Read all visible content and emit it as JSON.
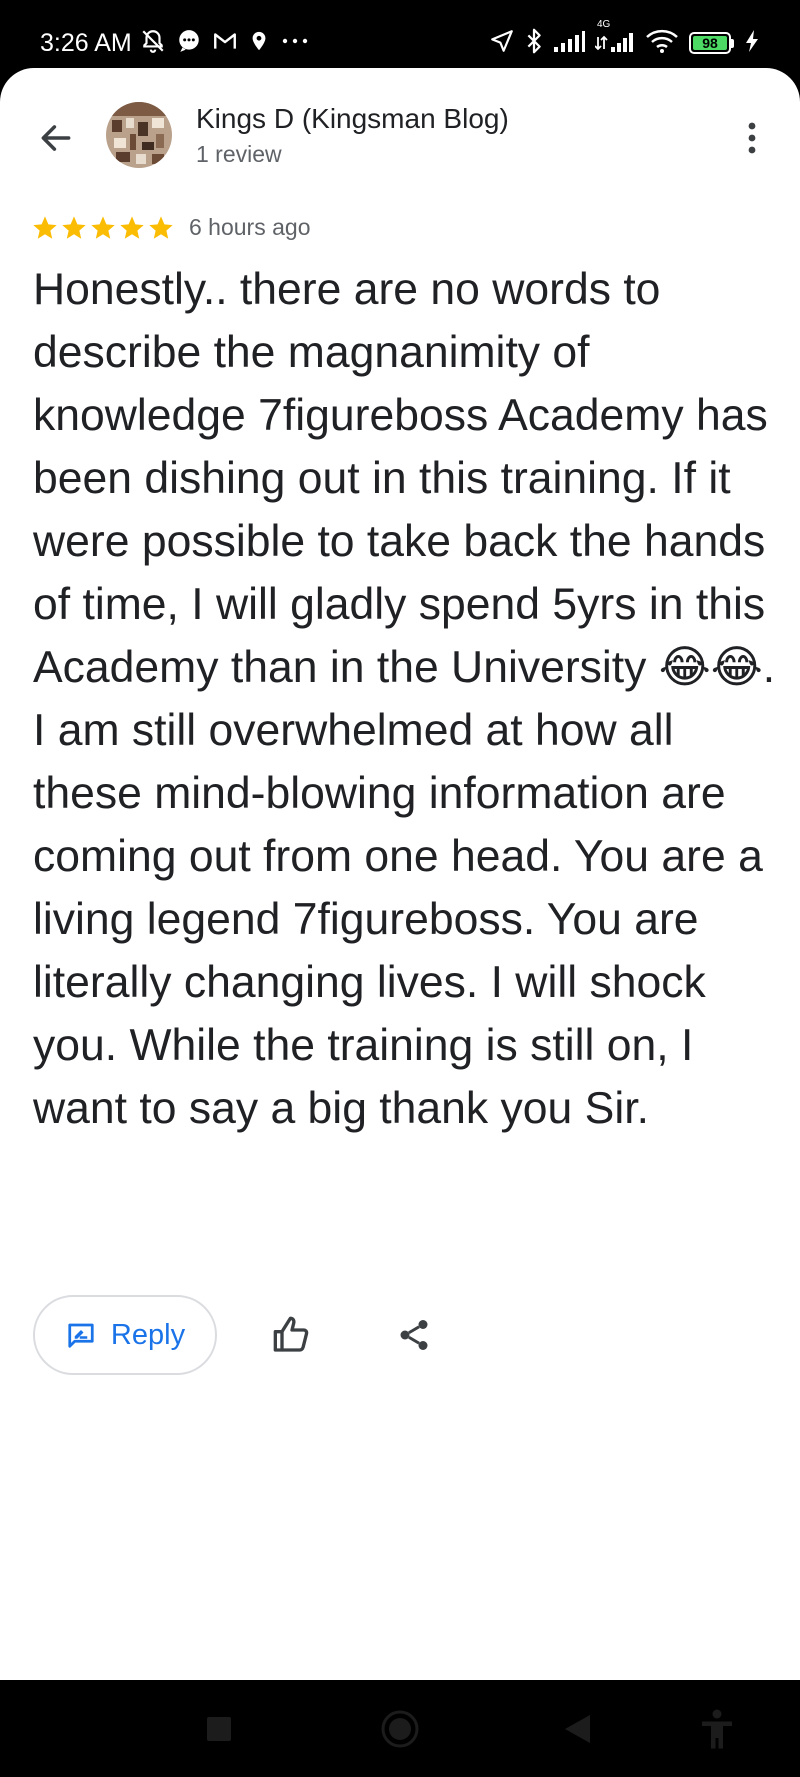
{
  "status_bar": {
    "time": "3:26 AM",
    "battery_level": "98",
    "network_label": "4G",
    "left_icons": [
      "notifications-off-icon",
      "chat-bubble-icon",
      "gmail-icon",
      "location-pin-icon",
      "more-dots-icon"
    ],
    "right_icons": [
      "navigation-arrow-icon",
      "bluetooth-icon",
      "signal-icon",
      "signal-4g-icon",
      "wifi-icon",
      "battery-icon",
      "charging-icon"
    ],
    "battery_color": "#4cd964"
  },
  "header": {
    "back_icon": "arrow-back-icon",
    "author_name": "Kings D (Kingsman Blog)",
    "review_count": "1 review",
    "more_icon": "more-vert-icon"
  },
  "review": {
    "rating": 5,
    "max_rating": 5,
    "star_color": "#fbbc04",
    "time_ago": "6 hours ago",
    "text": "Honestly.. there are no words to describe the magnanimity of knowledge 7figureboss Academy has been dishing out in this training. If it were possible to take back the hands of time, I will gladly spend 5yrs in this Academy than in the University 😂😂. I am still overwhelmed at how all these mind-blowing information are coming out from one head. You are a living legend 7figureboss. You are literally changing lives. I will shock you. While the training is still on, I want to say a big thank you Sir."
  },
  "actions": {
    "reply_label": "Reply",
    "reply_icon": "rate-review-icon",
    "like_icon": "thumb-up-icon",
    "share_icon": "share-icon",
    "accent_color": "#1a73e8"
  },
  "nav_bar": {
    "icons": [
      "recents-square-icon",
      "home-circle-icon",
      "back-triangle-icon",
      "accessibility-icon"
    ]
  }
}
